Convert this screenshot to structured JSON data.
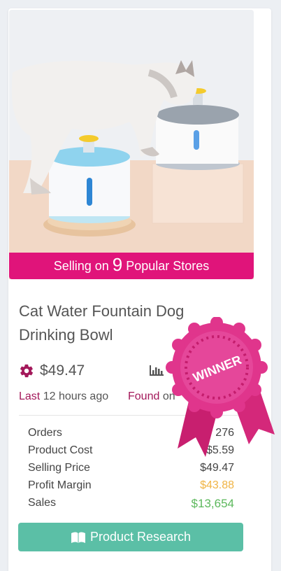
{
  "product": {
    "image_alt": "Cat drinking from pet water fountain",
    "stores_prefix": "Selling on",
    "stores_count": "9",
    "stores_suffix": "Popular Stores",
    "title": "Cat Water Fountain Dog Drinking Bowl",
    "price": "$49.47",
    "last_label": "Last",
    "last_value": "12 hours ago",
    "found_label": "Found",
    "found_value": "on"
  },
  "badge": {
    "text": "WINNER"
  },
  "stats": [
    {
      "label": "Orders",
      "value": "276"
    },
    {
      "label": "Product Cost",
      "value": "$5.59"
    },
    {
      "label": "Selling Price",
      "value": "$49.47"
    },
    {
      "label": "Profit Margin",
      "value": "$43.88"
    },
    {
      "label": "Sales",
      "value": "$13,654"
    }
  ],
  "actions": {
    "research_label": "Product Research"
  },
  "icons": {
    "settings": "gear-icon",
    "chart": "bar-chart-icon",
    "research": "book-icon"
  },
  "colors": {
    "banner": "#e0147a",
    "accent": "#a3185a",
    "button": "#5bbfa6",
    "margin": "#f0b445",
    "sales": "#5cb85c",
    "badge": "#e0358c"
  }
}
